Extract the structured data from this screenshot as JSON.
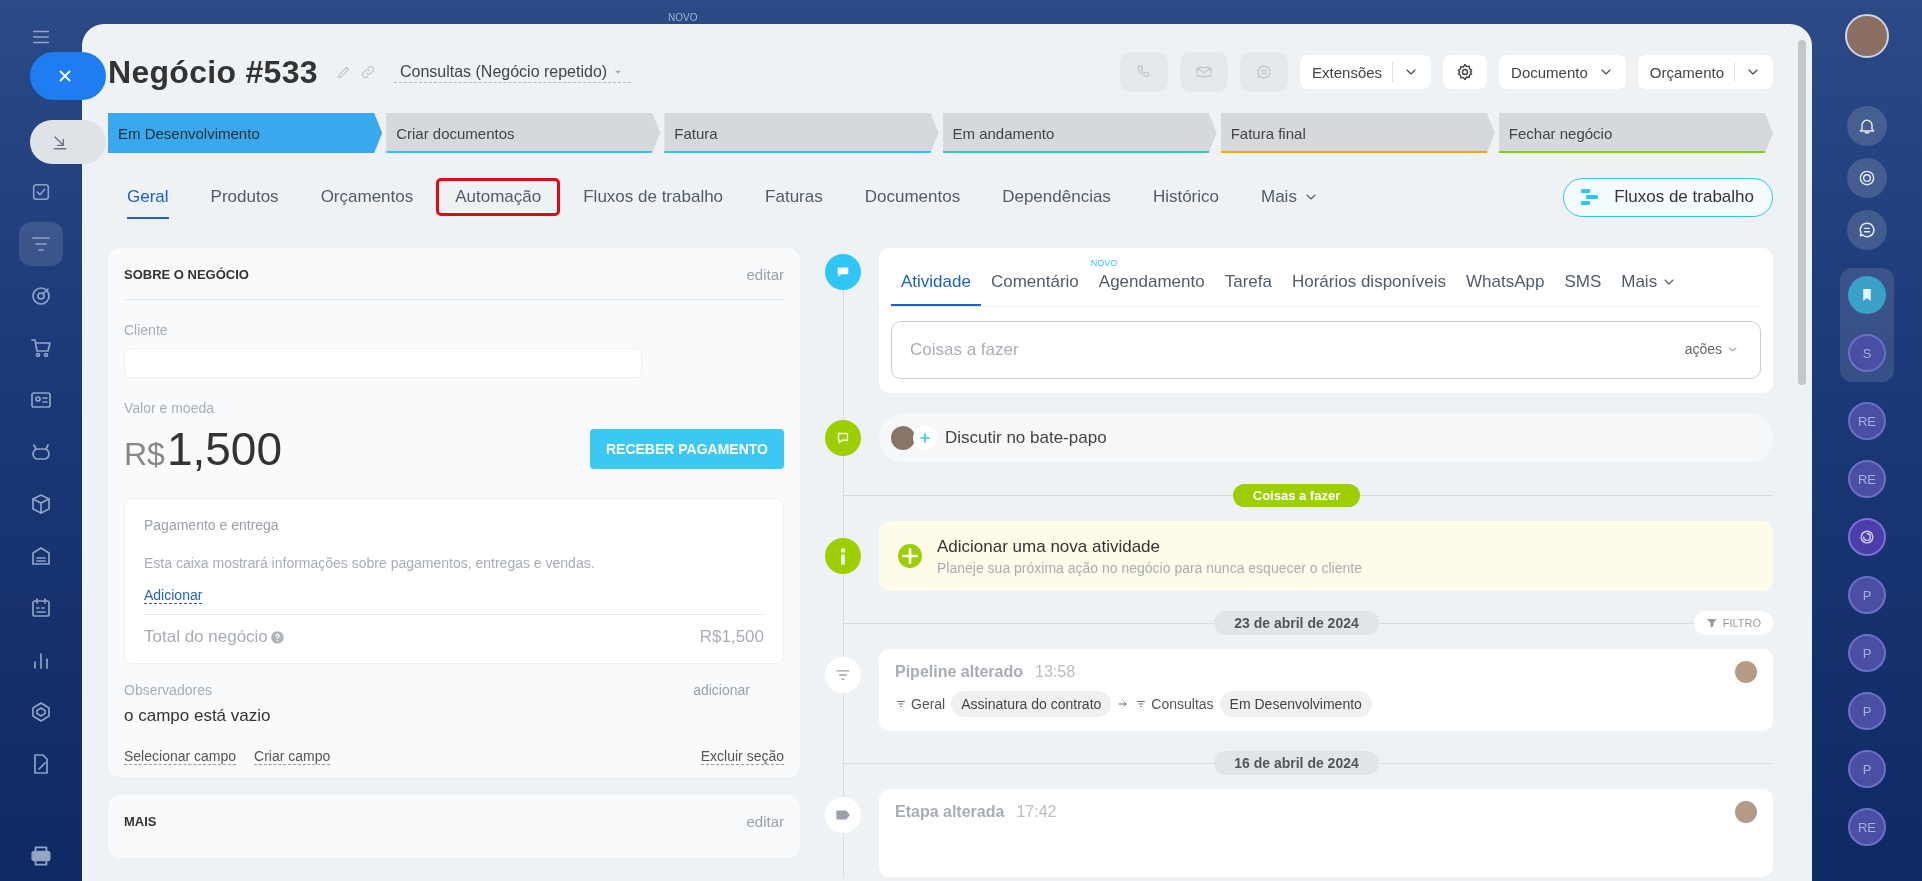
{
  "background_label": "NOVO",
  "deal": {
    "title": "Negócio #533",
    "pipeline": "Consultas (Negócio repetido)"
  },
  "header_buttons": {
    "extensions": "Extensões",
    "document": "Documento",
    "estimate": "Orçamento"
  },
  "stages": [
    {
      "label": "Em Desenvolvimento",
      "selected": true,
      "color": "#39a8ef"
    },
    {
      "label": "Criar documentos",
      "selected": false,
      "color": "#2fc6f6"
    },
    {
      "label": "Fatura",
      "selected": false,
      "color": "#2fc6f6"
    },
    {
      "label": "Em andamento",
      "selected": false,
      "color": "#2fd1bb"
    },
    {
      "label": "Fatura final",
      "selected": false,
      "color": "#f7a700"
    },
    {
      "label": "Fechar negócio",
      "selected": false,
      "color": "#7bd500"
    }
  ],
  "tabs": [
    {
      "label": "Geral",
      "selected": true,
      "highlighted": false,
      "kind": "tab"
    },
    {
      "label": "Produtos",
      "selected": false,
      "highlighted": false,
      "kind": "tab"
    },
    {
      "label": "Orçamentos",
      "selected": false,
      "highlighted": false,
      "kind": "tab"
    },
    {
      "label": "Automação",
      "selected": false,
      "highlighted": true,
      "kind": "tab"
    },
    {
      "label": "Fluxos de trabalho",
      "selected": false,
      "highlighted": false,
      "kind": "tab"
    },
    {
      "label": "Faturas",
      "selected": false,
      "highlighted": false,
      "kind": "tab"
    },
    {
      "label": "Documentos",
      "selected": false,
      "highlighted": false,
      "kind": "tab"
    },
    {
      "label": "Dependências",
      "selected": false,
      "highlighted": false,
      "kind": "tab"
    },
    {
      "label": "Histórico",
      "selected": false,
      "highlighted": false,
      "kind": "tab"
    },
    {
      "label": "Mais",
      "selected": false,
      "highlighted": false,
      "kind": "menu"
    }
  ],
  "workflow_button": "Fluxos de trabalho",
  "about": {
    "title": "SOBRE O NEGÓCIO",
    "edit": "editar",
    "client_label": "Cliente",
    "amount_label": "Valor e moeda",
    "currency": "R$",
    "amount": "1,500",
    "pay_button": "RECEBER PAGAMENTO",
    "payment": {
      "title": "Pagamento e entrega",
      "description": "Esta caixa mostrará informações sobre pagamentos, entregas e vendas.",
      "add_link": "Adicionar",
      "total_label": "Total do negócio",
      "total": "R$1,500"
    },
    "observers_label": "Observadores",
    "observers_add": "adicionar",
    "observers_value": "o campo está vazio",
    "links": [
      "Selecionar campo",
      "Criar campo"
    ],
    "delete_link": "Excluir seção"
  },
  "more_section": {
    "title": "MAIS",
    "edit": "editar"
  },
  "activity": {
    "tabs": [
      {
        "label": "Atividade",
        "selected": true,
        "kind": "tab"
      },
      {
        "label": "Comentário",
        "selected": false,
        "kind": "tab"
      },
      {
        "label": "Agendamento",
        "selected": false,
        "kind": "tab",
        "badge": "NOVO"
      },
      {
        "label": "Tarefa",
        "selected": false,
        "kind": "tab"
      },
      {
        "label": "Horários disponíveis",
        "selected": false,
        "kind": "tab"
      },
      {
        "label": "WhatsApp",
        "selected": false,
        "kind": "tab"
      },
      {
        "label": "SMS",
        "selected": false,
        "kind": "tab"
      },
      {
        "label": "Mais",
        "selected": false,
        "kind": "menu"
      }
    ],
    "placeholder": "Coisas a fazer",
    "actions": "ações"
  },
  "chat": {
    "label": "Discutir no bate-papo"
  },
  "todo_divider": "Coisas a fazer",
  "new_activity": {
    "title": "Adicionar uma nova atividade",
    "subtitle": "Planeje sua próxima ação no negócio para nunca esquecer o cliente"
  },
  "timeline": [
    {
      "kind": "date",
      "label": "23 de abril de 2024",
      "filter": "FILTRO"
    },
    {
      "kind": "pipeline",
      "title": "Pipeline alterado",
      "time": "13:58",
      "from_pipeline": "Geral",
      "from_stage": "Assinatura do contrato",
      "to_pipeline": "Consultas",
      "to_stage": "Em Desenvolvimento"
    },
    {
      "kind": "date",
      "label": "16 de abril de 2024"
    },
    {
      "kind": "stage",
      "title": "Etapa alterada",
      "time": "17:42"
    }
  ],
  "right_rail": [
    {
      "kind": "bookmark"
    },
    {
      "kind": "letters",
      "label": "S"
    },
    {
      "kind": "letters",
      "label": "RE"
    },
    {
      "kind": "letters",
      "label": "RE"
    },
    {
      "kind": "logo"
    },
    {
      "kind": "letters",
      "label": "P"
    },
    {
      "kind": "letters",
      "label": "P"
    },
    {
      "kind": "letters",
      "label": "P"
    },
    {
      "kind": "letters",
      "label": "P"
    },
    {
      "kind": "letters",
      "label": "RE"
    }
  ]
}
